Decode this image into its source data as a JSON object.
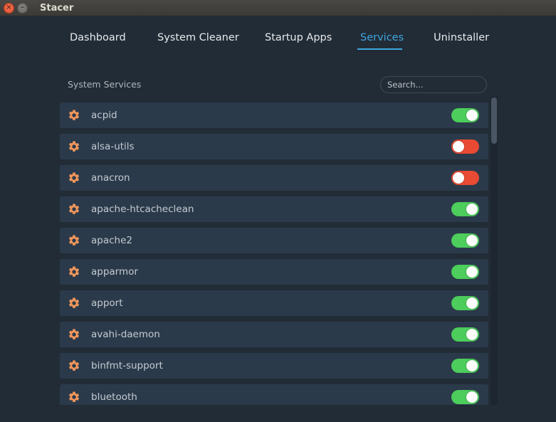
{
  "window": {
    "title": "Stacer",
    "close_icon": "close-icon",
    "minimize_icon": "minimize-icon"
  },
  "tabs": [
    {
      "label": "Dashboard",
      "active": false
    },
    {
      "label": "System Cleaner",
      "active": false
    },
    {
      "label": "Startup Apps",
      "active": false
    },
    {
      "label": "Services",
      "active": true
    },
    {
      "label": "Uninstaller",
      "active": false
    }
  ],
  "services": {
    "section_label": "System Services",
    "search_placeholder": "Search...",
    "search_value": "",
    "item_icon": "gear-icon",
    "colors": {
      "accent": "#3ea6e0",
      "gear": "#f0965a",
      "toggle_on": "#4ccd5c",
      "toggle_off": "#e94a33"
    },
    "items": [
      {
        "name": "acpid",
        "enabled": true
      },
      {
        "name": "alsa-utils",
        "enabled": false
      },
      {
        "name": "anacron",
        "enabled": false
      },
      {
        "name": "apache-htcacheclean",
        "enabled": true
      },
      {
        "name": "apache2",
        "enabled": true
      },
      {
        "name": "apparmor",
        "enabled": true
      },
      {
        "name": "apport",
        "enabled": true
      },
      {
        "name": "avahi-daemon",
        "enabled": true
      },
      {
        "name": "binfmt-support",
        "enabled": true
      },
      {
        "name": "bluetooth",
        "enabled": true
      }
    ]
  }
}
